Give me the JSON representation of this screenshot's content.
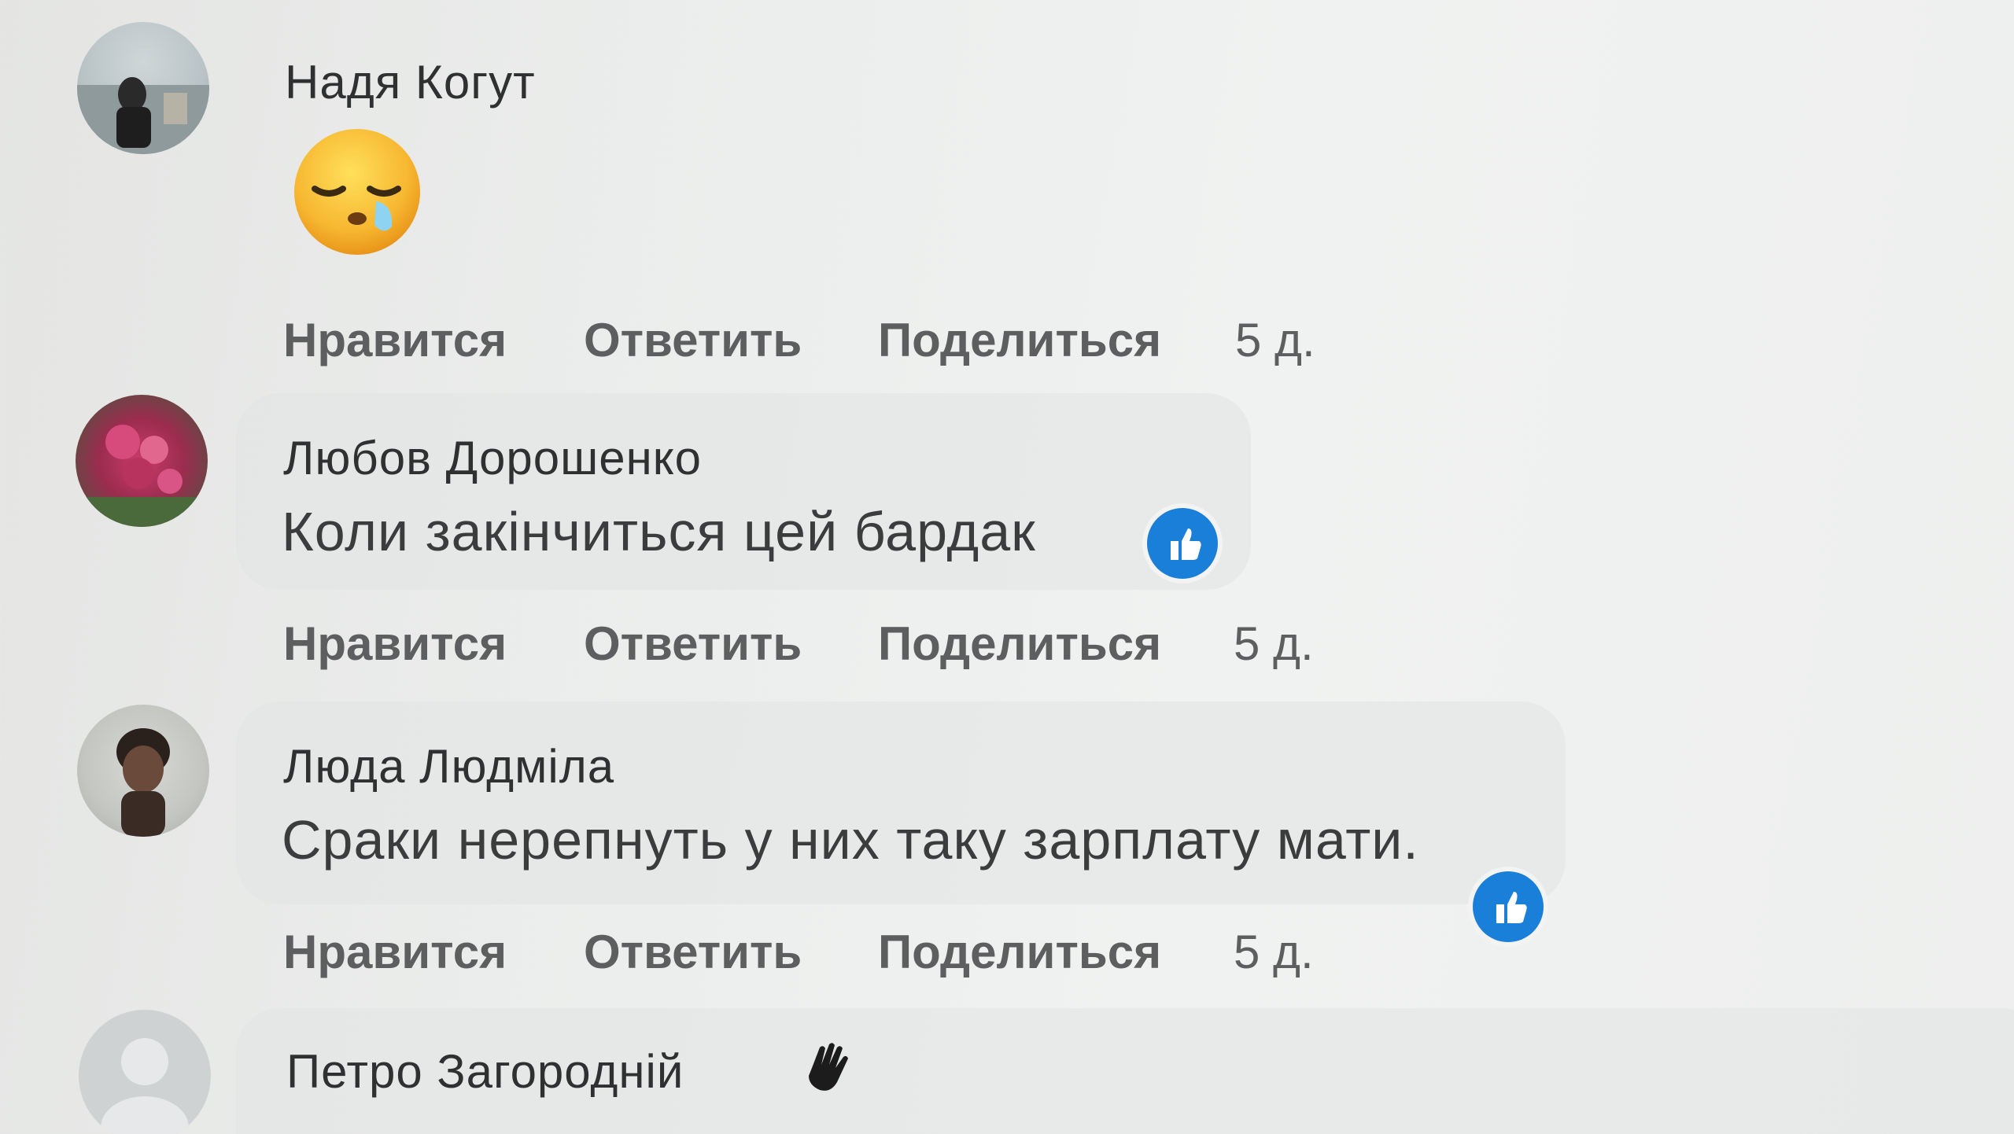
{
  "actions": {
    "like": "Нравится",
    "reply": "Ответить",
    "share": "Поделиться"
  },
  "comments": [
    {
      "author": "Надя Когут",
      "text": "",
      "emoji": "sleepy-face-emoji",
      "time": "5 д."
    },
    {
      "author": "Любов Дорошенко",
      "text": "Коли закінчиться цей бардак",
      "reaction": "like-icon",
      "time": "5 д."
    },
    {
      "author": "Люда Людміла",
      "text": "Сраки нерепнуть у них таку зарплату мати.",
      "reaction": "like-icon",
      "time": "5 д."
    },
    {
      "author": "Петро Загородній",
      "badge": "waving-hand-icon"
    }
  ],
  "colors": {
    "like_blue": "#1a7fd8",
    "text": "#3b3c3d",
    "action_text": "#5c5e60"
  }
}
